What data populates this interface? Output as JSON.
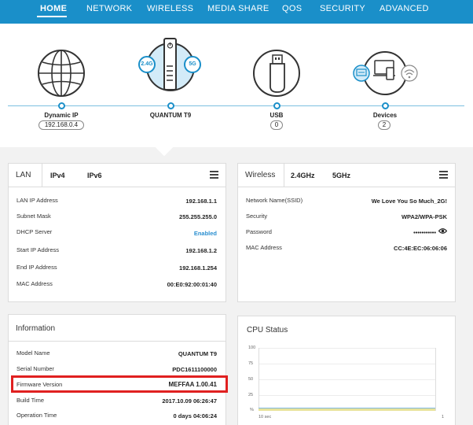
{
  "nav": {
    "items": [
      "HOME",
      "NETWORK",
      "WIRELESS",
      "MEDIA SHARE",
      "QOS",
      "SECURITY",
      "ADVANCED"
    ]
  },
  "topology": {
    "internet": {
      "label": "Dynamic IP",
      "value": "192.168.0.4",
      "icon": "globe-icon"
    },
    "router": {
      "label": "QUANTUM T9",
      "band1": "2.4G",
      "band2": "5G",
      "icon": "router-icon"
    },
    "usb": {
      "label": "USB",
      "value": "0",
      "icon": "usb-drive-icon"
    },
    "devices": {
      "label": "Devices",
      "value": "2",
      "icon": "devices-icon"
    }
  },
  "lan": {
    "title": "LAN",
    "tabs": [
      "IPv4",
      "IPv6"
    ],
    "rows": [
      {
        "label": "LAN IP Address",
        "value": "192.168.1.1"
      },
      {
        "label": "Subnet Mask",
        "value": "255.255.255.0"
      },
      {
        "label": "DHCP Server",
        "value": "Enabled"
      },
      {
        "label": "Start IP Address",
        "value": "192.168.1.2"
      },
      {
        "label": "End IP Address",
        "value": "192.168.1.254"
      },
      {
        "label": "MAC Address",
        "value": "00:E0:92:00:01:40"
      }
    ]
  },
  "wireless": {
    "title": "Wireless",
    "tabs": [
      "2.4GHz",
      "5GHz"
    ],
    "rows": [
      {
        "label": "Network Name(SSID)",
        "value": "We Love You So Much_2G!"
      },
      {
        "label": "Security",
        "value": "WPA2/WPA-PSK"
      },
      {
        "label": "Password",
        "value": "•••••••••••"
      },
      {
        "label": "MAC Address",
        "value": "CC:4E:EC:06:06:06"
      }
    ]
  },
  "information": {
    "title": "Information",
    "rows": [
      {
        "label": "Model Name",
        "value": "QUANTUM T9"
      },
      {
        "label": "Serial Number",
        "value": "PDC1611100000"
      },
      {
        "label": "Firmware Version",
        "value": "MEFFAA 1.00.41"
      },
      {
        "label": "Build Time",
        "value": "2017.10.09 06:26:47"
      },
      {
        "label": "Operation Time",
        "value": "0 days 04:06:24"
      }
    ]
  },
  "cpu": {
    "title": "CPU Status",
    "y_ticks": [
      "100",
      "75",
      "50",
      "25",
      "%"
    ],
    "x_start": "10 sec",
    "x_end": "1"
  },
  "colors": {
    "nav_bg": "#1a8fc9",
    "accent": "#1a8fc9",
    "link": "#2a8fd0",
    "highlight": "#e02020"
  }
}
